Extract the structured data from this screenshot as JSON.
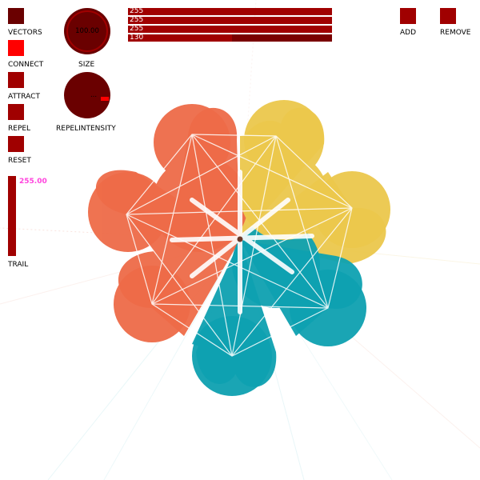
{
  "toggles": {
    "vectors": {
      "label": "VECTORS",
      "state": "dark"
    },
    "connect": {
      "label": "CONNECT",
      "state": "on"
    },
    "attract": {
      "label": "ATTRACT",
      "state": "off"
    },
    "repel": {
      "label": "REPEL",
      "state": "off"
    },
    "reset": {
      "label": "RESET",
      "state": "off"
    },
    "add": {
      "label": "ADD",
      "state": "off"
    },
    "remove": {
      "label": "REMOVE",
      "state": "off"
    }
  },
  "knobs": {
    "size": {
      "label": "SIZE",
      "value": "100.00"
    },
    "repel_intensity": {
      "label": "REPELINTENSITY",
      "value": "..."
    }
  },
  "sliders": [
    {
      "value": "255",
      "fraction": 1.0
    },
    {
      "value": "255",
      "fraction": 1.0
    },
    {
      "value": "255",
      "fraction": 1.0
    },
    {
      "value": "130",
      "fraction": 0.51
    }
  ],
  "trail": {
    "label": "TRAIL",
    "value": "255.00"
  },
  "colors": {
    "control": "#a00000",
    "control_active": "#ff0000",
    "control_dark": "#6a0000",
    "petal_orange": "#ee6b48",
    "petal_yellow": "#ecc84c",
    "petal_teal": "#0ea1b1",
    "trail_value_text": "#ff44dd"
  }
}
